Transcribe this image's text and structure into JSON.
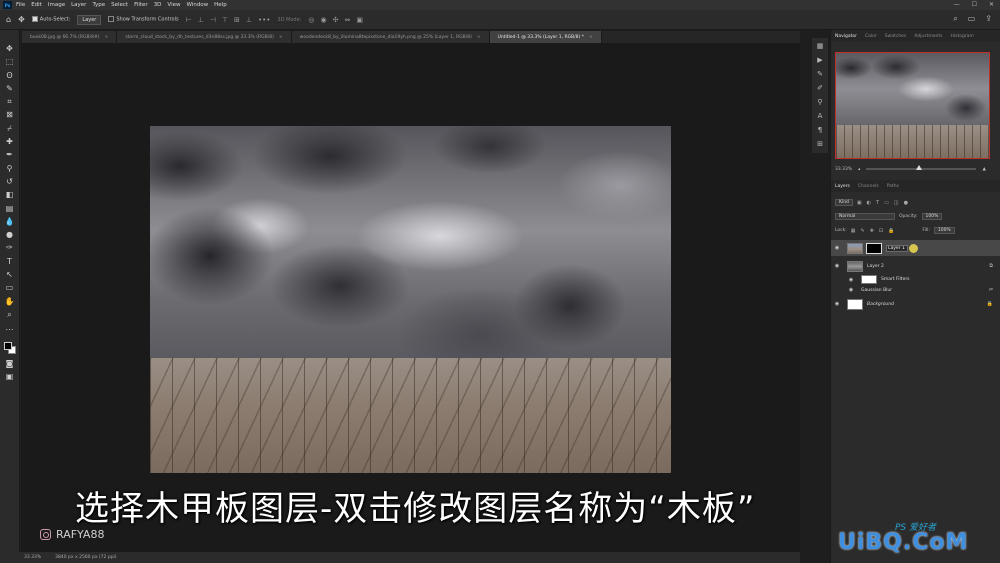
{
  "menu": [
    "File",
    "Edit",
    "Image",
    "Layer",
    "Type",
    "Select",
    "Filter",
    "3D",
    "View",
    "Window",
    "Help"
  ],
  "app_logo": "Ps",
  "options": {
    "auto_select": "Auto-Select:",
    "auto_select_target": "Layer",
    "show_transform": "Show Transform Controls",
    "mode_3d": "3D Mode:"
  },
  "tabs": [
    {
      "label": "book08.jpg @ 66.7% (RGB/8#)"
    },
    {
      "label": "storm_cloud_stock_by_dh_textures_d3n88ss.jpg @ 33.3% (RGB/8)"
    },
    {
      "label": "woodendeck8_by_illumina8tepixstone_dia19yh.png @ 25% (Layer 1, RGB/8)"
    },
    {
      "label": "Untitled-1 @ 33.3% (Layer 1, RGB/8) *"
    }
  ],
  "status": {
    "zoom": "33.33%",
    "doc_size": "3840 px x 2560 px (72 ppi)"
  },
  "subtitle": "选择木甲板图层-双击修改图层名称为“木板”",
  "watermark": "RAFYA88",
  "site_watermark": "UiBQ.CoM",
  "ps_badge": "PS 爱好者",
  "panel_tabs": [
    "Navigator",
    "Color",
    "Swatches",
    "Adjustments",
    "Histogram"
  ],
  "navigator_zoom": "33.33%",
  "layers_tabs": [
    "Layers",
    "Channels",
    "Paths"
  ],
  "layers_controls": {
    "filter_kind": "Kind",
    "blend_mode": "Normal",
    "opacity_label": "Opacity:",
    "opacity_value": "100%",
    "lock_label": "Lock:",
    "fill_label": "Fill:",
    "fill_value": "100%"
  },
  "layers": {
    "layer1_name": "Layer 1",
    "layer2_name": "Layer 2",
    "smart_filters": "Smart Filters",
    "gaussian_blur": "Gaussian Blur",
    "background": "Background"
  }
}
